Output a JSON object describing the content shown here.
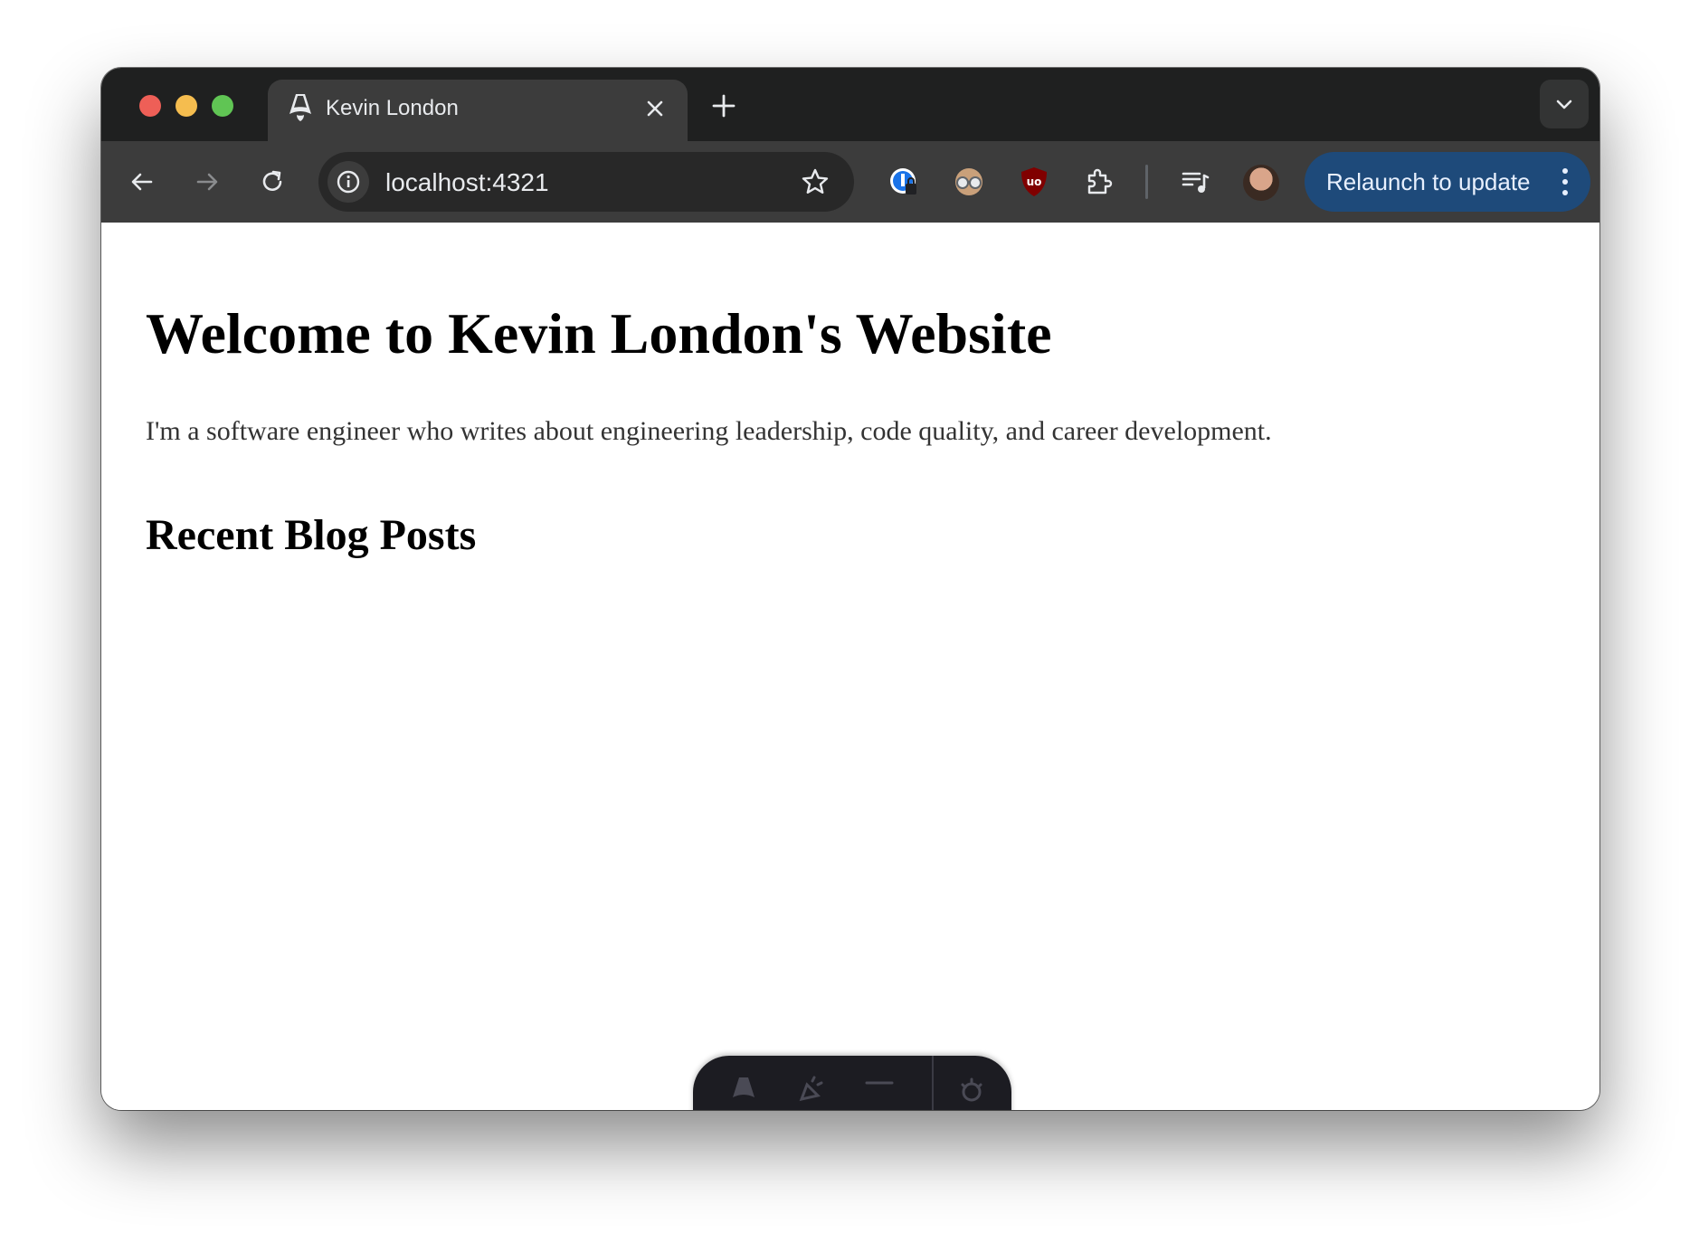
{
  "browser": {
    "tab": {
      "title": "Kevin London"
    },
    "address_bar": {
      "url": "localhost:4321"
    },
    "relaunch_button": {
      "label": "Relaunch to update"
    },
    "colors": {
      "tabstrip": "#1f2020",
      "toolbar": "#3c3c3c",
      "relaunch": "#1e4a7a"
    },
    "toolbar_icons": [
      "back-arrow-icon",
      "forward-arrow-icon",
      "reload-icon",
      "site-info-icon",
      "bookmark-star-icon",
      "password-manager-extension-icon",
      "glasses-extension-icon",
      "ublock-origin-icon",
      "extensions-puzzle-icon",
      "media-controls-icon",
      "profile-avatar"
    ]
  },
  "page": {
    "heading": "Welcome to Kevin London's Website",
    "intro": "I'm a software engineer who writes about engineering leadership, code quality, and career development.",
    "section_heading": "Recent Blog Posts"
  },
  "dev_toolbar": {
    "icons": [
      "astro-logo-icon",
      "audit-icon",
      "inspect-icon",
      "settings-gear-icon"
    ]
  }
}
